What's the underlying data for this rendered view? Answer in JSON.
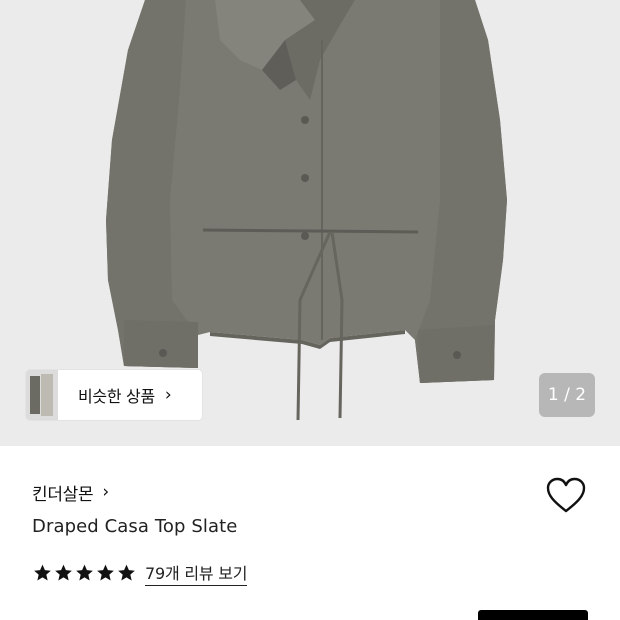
{
  "image": {
    "pager": "1 / 2",
    "similar_label": "비슷한 상품",
    "similar_chevron": "›"
  },
  "product": {
    "brand": "킨더살몬",
    "brand_chevron": "›",
    "name": "Draped Casa Top Slate",
    "rating": 5,
    "review_link": "79개 리뷰 보기"
  },
  "colors": {
    "garment": "#7b7a72",
    "background": "#ebebeb",
    "star": "#111111",
    "cta": "#000000"
  },
  "icons": {
    "wishlist": "heart-outline-icon",
    "chevron": "chevron-right-icon",
    "star": "star-filled-icon"
  }
}
